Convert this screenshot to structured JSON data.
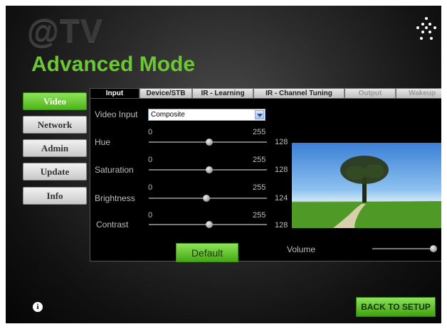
{
  "brand": "@TV",
  "title": "Advanced Mode",
  "sidebar": {
    "items": [
      {
        "label": "Video",
        "active": true
      },
      {
        "label": "Network"
      },
      {
        "label": "Admin"
      },
      {
        "label": "Update"
      },
      {
        "label": "Info"
      }
    ]
  },
  "tabs": [
    {
      "label": "Input",
      "state": "active"
    },
    {
      "label": "Device/STB",
      "state": "normal"
    },
    {
      "label": "IR - Learning",
      "state": "normal"
    },
    {
      "label": "IR - Channel Tuning",
      "state": "normal"
    },
    {
      "label": "Output",
      "state": "disabled"
    },
    {
      "label": "Wakeup",
      "state": "disabled"
    }
  ],
  "video_input": {
    "label": "Video Input",
    "value": "Composite"
  },
  "sliders": [
    {
      "label": "Hue",
      "min": "0",
      "max": "255",
      "value": "128",
      "level": 128
    },
    {
      "label": "Saturation",
      "min": "0",
      "max": "255",
      "value": "128",
      "level": 128
    },
    {
      "label": "Brightness",
      "min": "0",
      "max": "255",
      "value": "124",
      "level": 124
    },
    {
      "label": "Contrast",
      "min": "0",
      "max": "255",
      "value": "128",
      "level": 128
    }
  ],
  "volume": {
    "label": "Volume",
    "level": 0.95
  },
  "buttons": {
    "default": "Default",
    "back": "BACK TO SETUP"
  },
  "icons": {
    "info": "info-icon",
    "logo": "dots-logo-icon",
    "dropdown": "chevron-down-icon"
  },
  "colors": {
    "accent": "#6cc832",
    "button_green": "#4db519"
  }
}
